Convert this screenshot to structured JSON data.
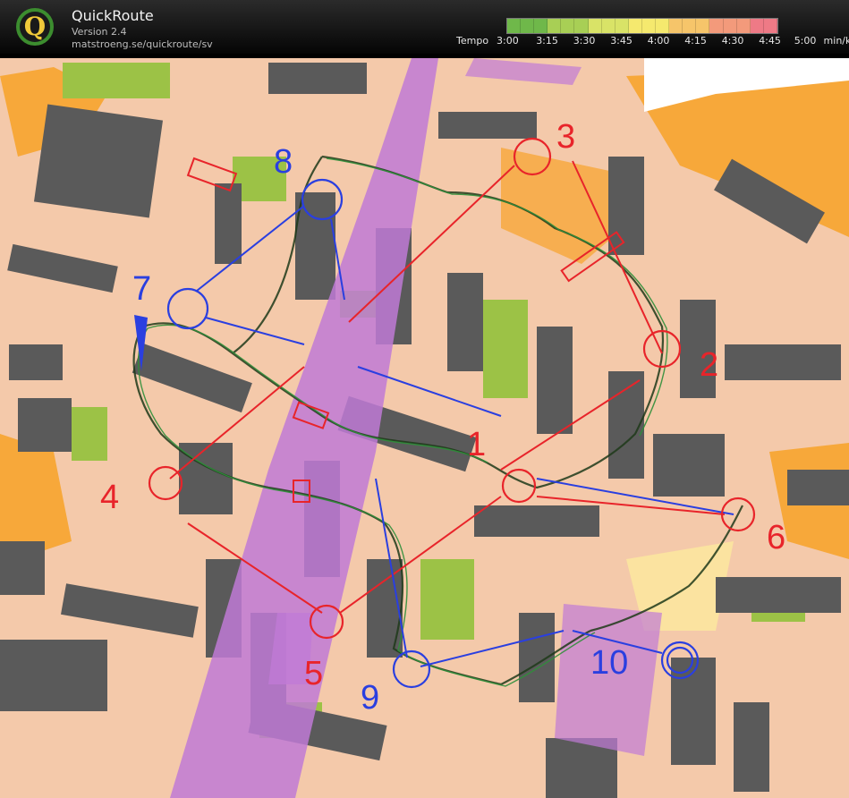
{
  "app": {
    "title": "QuickRoute",
    "version": "Version 2.4",
    "url": "matstroeng.se/quickroute/sv"
  },
  "tempo": {
    "label": "Tempo",
    "ticks": [
      "3:00",
      "3:15",
      "3:30",
      "3:45",
      "4:00",
      "4:15",
      "4:30",
      "4:45",
      "5:00"
    ],
    "unit": "min/km",
    "gradient_colors": [
      "#6fb84a",
      "#a8cf55",
      "#d9e367",
      "#f5e96e",
      "#f6c56a",
      "#f39a7b",
      "#ee7a86"
    ]
  },
  "controls": {
    "red": [
      "1",
      "2",
      "3",
      "4",
      "5",
      "6"
    ],
    "blue": [
      "7",
      "8",
      "9",
      "10"
    ]
  }
}
